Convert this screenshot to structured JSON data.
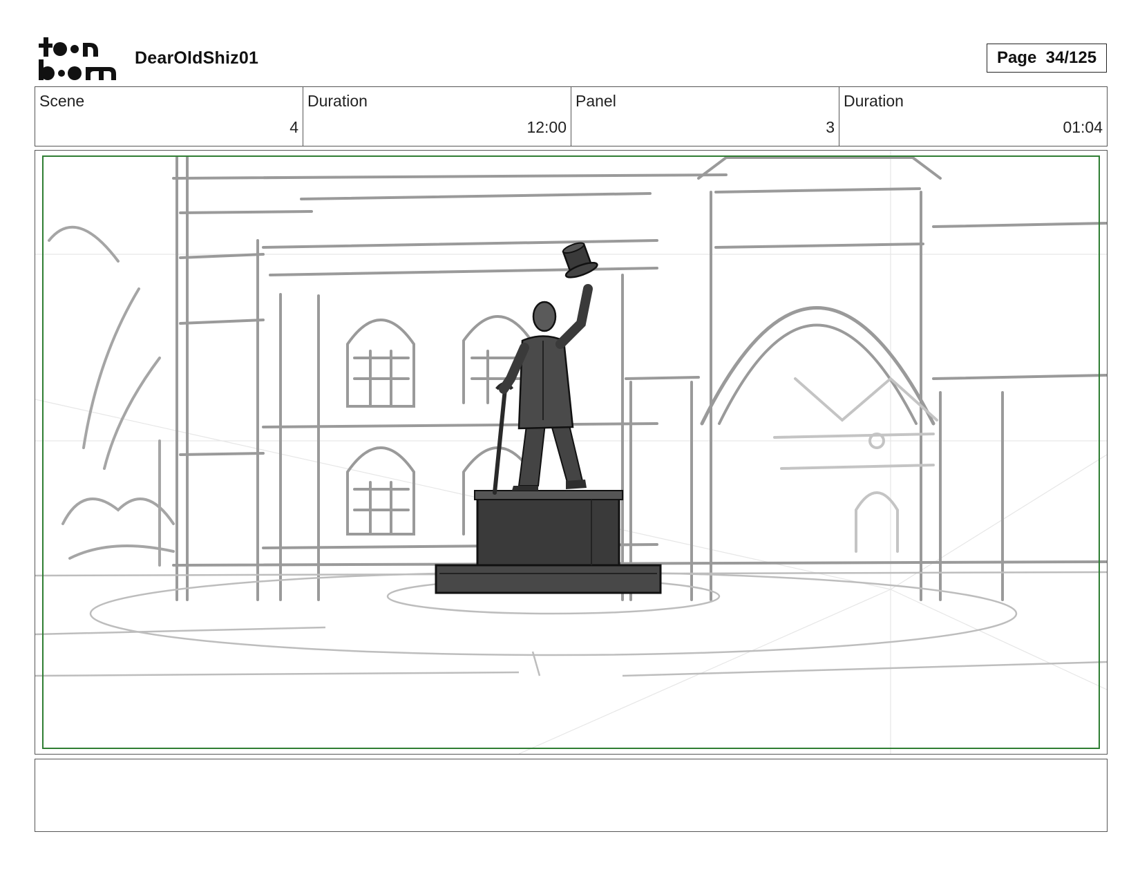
{
  "header": {
    "logo_text": "toon boom",
    "project_title": "DearOldShiz01",
    "page_label": "Page  34/125"
  },
  "info": {
    "scene_label": "Scene",
    "scene_value": "4",
    "scene_duration_label": "Duration",
    "scene_duration_value": "12:00",
    "panel_label": "Panel",
    "panel_value": "3",
    "panel_duration_label": "Duration",
    "panel_duration_value": "01:04"
  },
  "panel": {
    "safe_frame_color": "#2e7d32",
    "sketch_color": "#9a9a9a",
    "statue_color": "#3c3c3c"
  },
  "notes": {
    "text": ""
  }
}
